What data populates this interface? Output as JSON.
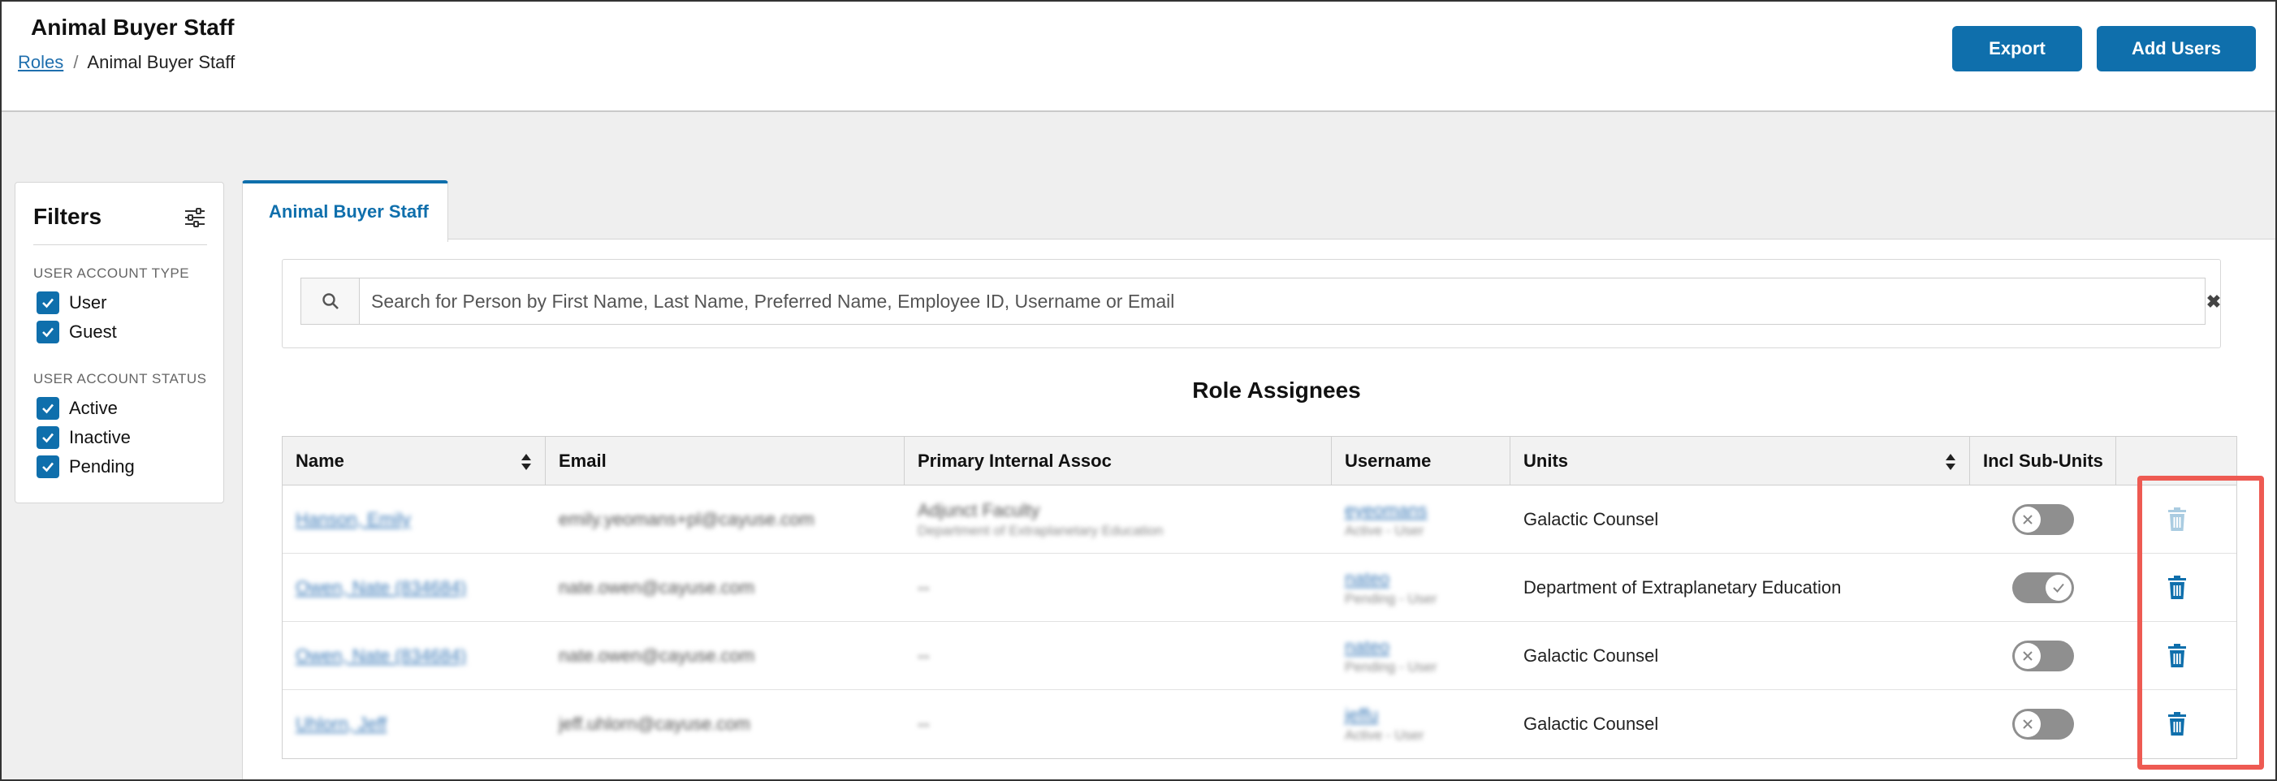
{
  "header": {
    "title": "Animal Buyer Staff",
    "breadcrumb_root": "Roles",
    "breadcrumb_sep": "/",
    "breadcrumb_current": "Animal Buyer Staff",
    "export_label": "Export",
    "add_users_label": "Add Users"
  },
  "filters": {
    "title": "Filters",
    "account_type_title": "USER ACCOUNT TYPE",
    "account_types": [
      "User",
      "Guest"
    ],
    "account_status_title": "USER ACCOUNT STATUS",
    "account_statuses": [
      "Active",
      "Inactive",
      "Pending"
    ]
  },
  "tab": {
    "label": "Animal Buyer Staff"
  },
  "search": {
    "placeholder": "Search for Person by First Name, Last Name, Preferred Name, Employee ID, Username or Email",
    "clear_label": "✖"
  },
  "table": {
    "title": "Role Assignees",
    "columns": [
      "Name",
      "Email",
      "Primary Internal Assoc",
      "Username",
      "Units",
      "Incl Sub-Units"
    ],
    "rows": [
      {
        "name": "Hanson, Emily",
        "email": "emily.yeomans+pl@cayuse.com",
        "assoc": "Adjunct Faculty",
        "assoc_sub": "Department of Extraplanetary Education",
        "username": "eyeomans",
        "username_sub": "Active - User",
        "unit": "Galactic Counsel",
        "incl_sub_units": false
      },
      {
        "name": "Owen, Nate (834684)",
        "email": "nate.owen@cayuse.com",
        "assoc": "--",
        "assoc_sub": "",
        "username": "nateo",
        "username_sub": "Pending - User",
        "unit": "Department of Extraplanetary Education",
        "incl_sub_units": true
      },
      {
        "name": "Owen, Nate (834684)",
        "email": "nate.owen@cayuse.com",
        "assoc": "--",
        "assoc_sub": "",
        "username": "nateo",
        "username_sub": "Pending - User",
        "unit": "Galactic Counsel",
        "incl_sub_units": false
      },
      {
        "name": "Uhlorn, Jeff",
        "email": "jeff.uhlorn@cayuse.com",
        "assoc": "--",
        "assoc_sub": "",
        "username": "jeffu",
        "username_sub": "Active - User",
        "unit": "Galactic Counsel",
        "incl_sub_units": false
      }
    ]
  },
  "colors": {
    "primary": "#0f6fac",
    "highlight": "#ee5a52",
    "toggle": "#8f8f8f"
  }
}
